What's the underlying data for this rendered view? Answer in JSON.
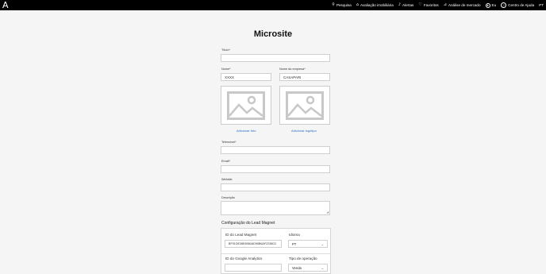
{
  "header": {
    "logo": "A",
    "nav": [
      {
        "icon": "search-icon",
        "glyph": "⚲",
        "label": "Pesquisa"
      },
      {
        "icon": "valuation-icon",
        "glyph": "⌂",
        "label": "Avaliação imobiliária"
      },
      {
        "icon": "bell-icon",
        "glyph": "♪",
        "label": "Alertas"
      },
      {
        "icon": "heart-icon",
        "glyph": "♡",
        "label": "Favoritos"
      },
      {
        "icon": "chart-icon",
        "glyph": "⊿",
        "label": "Análise de mercado"
      },
      {
        "icon": "user-icon",
        "glyph": "●",
        "label": "Eu"
      },
      {
        "icon": "help-icon",
        "glyph": "?",
        "label": "Centro de Ajuda"
      },
      {
        "icon": "",
        "glyph": "",
        "label": "PT"
      }
    ]
  },
  "title": "Microsite",
  "form": {
    "titulo": {
      "label": "Título*",
      "value": ""
    },
    "nome": {
      "label": "Nome*",
      "value": "XXXX"
    },
    "empresa": {
      "label": "Nome da empresa*",
      "value": "CASAPARI"
    },
    "add_photo": "Adicionar foto",
    "add_logo": "Adicionar logótipo",
    "telemovel": {
      "label": "Telemóvel*",
      "value": ""
    },
    "email": {
      "label": "Email*",
      "value": ""
    },
    "website": {
      "label": "Website",
      "value": ""
    },
    "descricao": {
      "label": "Descrição",
      "value": ""
    }
  },
  "lead_magnet": {
    "section_title": "Configuração do Lead Magnet",
    "id_label": "ID do Lead Magnet",
    "id_value": "BF91DE36E6960AD90B6AF2236D1",
    "idioma_label": "Idioma",
    "idioma_value": "PT",
    "ga_label": "ID do Google Analytics",
    "ga_value": "",
    "tipo_label": "Tipo de operação",
    "tipo_value": "Venda"
  }
}
